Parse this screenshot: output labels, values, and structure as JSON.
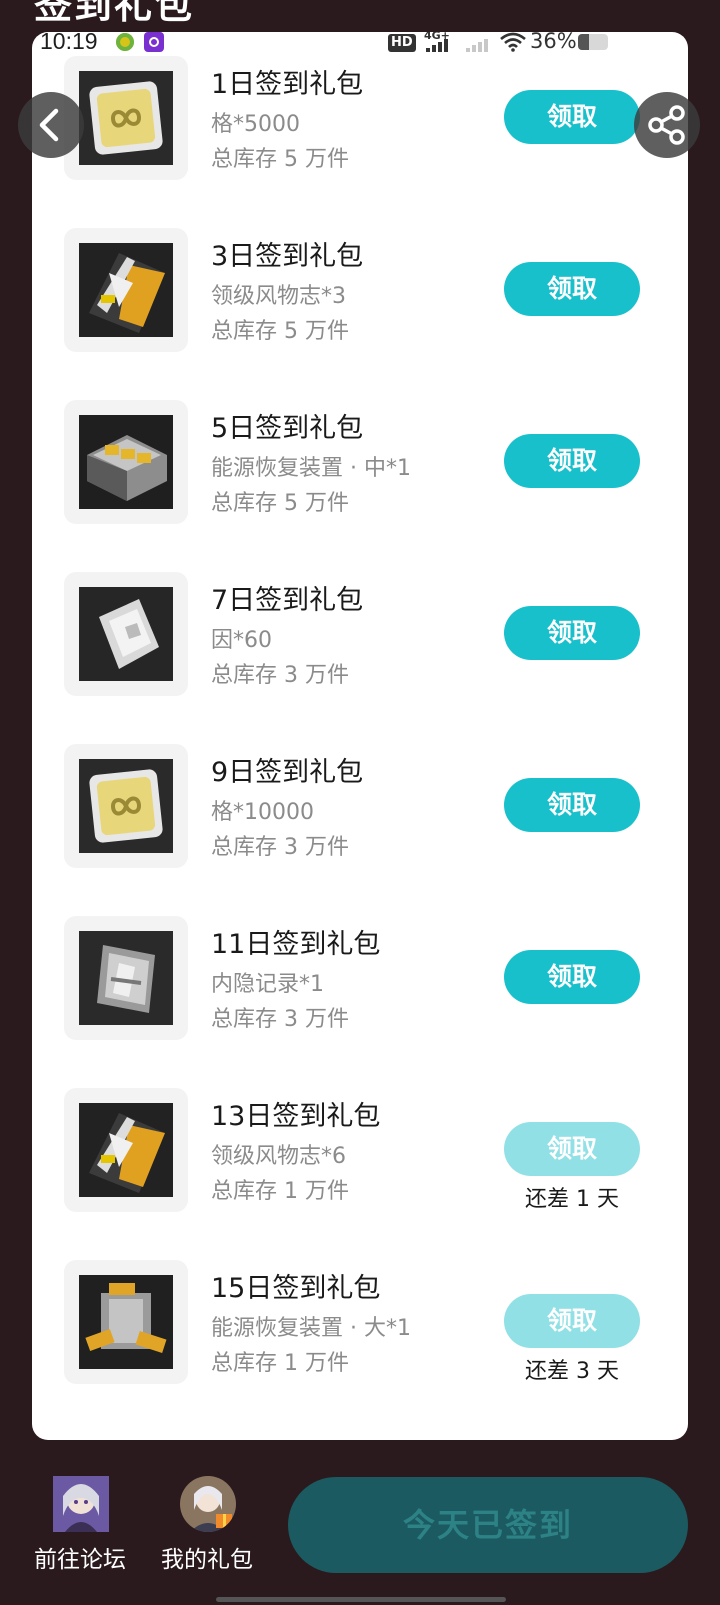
{
  "page": {
    "title": "签到礼包"
  },
  "status_bar": {
    "time": "10:19",
    "hd_label": "HD",
    "network_label": "4G+",
    "battery_text": "36%",
    "battery_level": 0.36
  },
  "gifts": [
    {
      "title": "1日签到礼包",
      "item": "格*5000",
      "stock": "总库存 5 万件",
      "button": "领取",
      "enabled": true,
      "remaining": "",
      "icon": "gold-chip-icon"
    },
    {
      "title": "3日签到礼包",
      "item": "领级风物志*3",
      "stock": "总库存 5 万件",
      "button": "领取",
      "enabled": true,
      "remaining": "",
      "icon": "exp-book-icon"
    },
    {
      "title": "5日签到礼包",
      "item": "能源恢复装置 · 中*1",
      "stock": "总库存 5 万件",
      "button": "领取",
      "enabled": true,
      "remaining": "",
      "icon": "energy-box-icon"
    },
    {
      "title": "7日签到礼包",
      "item": "因*60",
      "stock": "总库存 3 万件",
      "button": "领取",
      "enabled": true,
      "remaining": "",
      "icon": "silver-card-icon"
    },
    {
      "title": "9日签到礼包",
      "item": "格*10000",
      "stock": "总库存 3 万件",
      "button": "领取",
      "enabled": true,
      "remaining": "",
      "icon": "gold-chip-icon"
    },
    {
      "title": "11日签到礼包",
      "item": "内隐记录*1",
      "stock": "总库存 3 万件",
      "button": "领取",
      "enabled": true,
      "remaining": "",
      "icon": "record-plate-icon"
    },
    {
      "title": "13日签到礼包",
      "item": "领级风物志*6",
      "stock": "总库存 1 万件",
      "button": "领取",
      "enabled": false,
      "remaining": "还差 1 天",
      "icon": "exp-book-icon"
    },
    {
      "title": "15日签到礼包",
      "item": "能源恢复装置 · 大*1",
      "stock": "总库存 1 万件",
      "button": "领取",
      "enabled": false,
      "remaining": "还差 3 天",
      "icon": "energy-crate-icon"
    }
  ],
  "bottom_nav": {
    "forum_label": "前往论坛",
    "my_gifts_label": "我的礼包",
    "signed_label": "今天已签到"
  },
  "colors": {
    "accent": "#18c0cc",
    "accent_disabled": "#90e0e6",
    "background": "#2a1a1d",
    "signed_button": "#1b5a60"
  }
}
